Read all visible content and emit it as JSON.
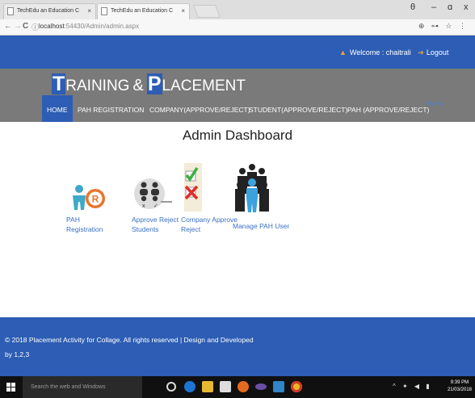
{
  "browser": {
    "tabs": [
      {
        "label": "TechEdu an Education C"
      },
      {
        "label": "TechEdu an Education C"
      }
    ],
    "tab_close": "×",
    "url_host": "localhost",
    "url_path": ":54430/Admin/admin.aspx",
    "window_controls": {
      "profile": "θ",
      "minimize": "–",
      "maximize": "ɑ",
      "close": "x"
    },
    "nav": {
      "back": "←",
      "forward": "→",
      "reload": "C",
      "info": "ⓘ"
    },
    "addr_actions": "⊕ ⊶ ☆ ⋮"
  },
  "header": {
    "welcome_text": "Welcome : chaitrali",
    "logout_label": "Logout",
    "brand": {
      "t": "T",
      "raining": "RAINING",
      "amp": "&",
      "p": "P",
      "lacement": "LACEMENT"
    }
  },
  "menu": {
    "items": [
      {
        "label": "HOME"
      },
      {
        "label": "PAH REGISTRATION"
      },
      {
        "label": "COMPANY(APPROVE/REJECT)"
      },
      {
        "label": "STUDENT(APPROVE/REJECT)"
      },
      {
        "label": "PAH (APPROVE/REJECT)"
      }
    ],
    "home_link": "Home"
  },
  "main": {
    "title": "Admin Dashboard",
    "tiles": [
      {
        "label_line1": "PAH",
        "label_line2": "Registration",
        "icon": "registered-user-icon"
      },
      {
        "label_line1": "Approve Reject",
        "label_line2": "Students",
        "icon": "students-approve-icon"
      },
      {
        "label_line1": "Company Approve",
        "label_line2": "Reject",
        "icon": "check-cross-icon"
      },
      {
        "label_line1": "Manage PAH User",
        "label_line2": "",
        "icon": "group-users-icon"
      }
    ]
  },
  "footer": {
    "line1": "© 2018 Placement Activity for Collage. All rights reserved | Design and Developed",
    "line2": "by 1,2,3"
  },
  "taskbar": {
    "search_placeholder": "Search the web and Windows",
    "time": "9:39 PM",
    "date": "21/03/2018"
  },
  "colors": {
    "primary": "#2d5db4",
    "band": "#7a7a7a",
    "link": "#3a70c2",
    "accent": "#f0a33a"
  }
}
